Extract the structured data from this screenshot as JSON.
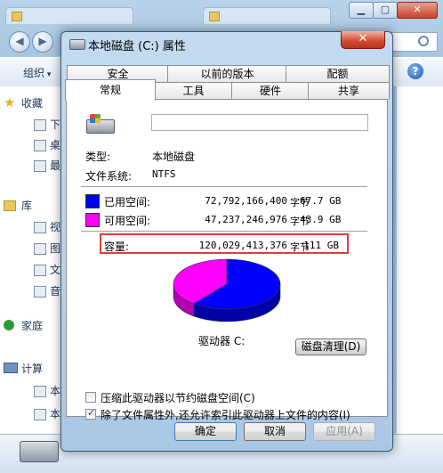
{
  "background": {
    "tabs": [
      "",
      ""
    ],
    "organize_label": "组织",
    "help_glyph": "?",
    "nav_items": [
      "收藏",
      "下",
      "桌",
      "最",
      "库",
      "视",
      "图",
      "文",
      "音",
      "家庭",
      "计算",
      "本",
      "本"
    ]
  },
  "dialog": {
    "title": "本地磁盘 (C:) 属性",
    "close_glyph": "✕",
    "tabs_back": [
      "安全",
      "以前的版本",
      "配额"
    ],
    "tabs_front": [
      "常规",
      "工具",
      "硬件",
      "共享"
    ],
    "name_value": "",
    "type_label": "类型:",
    "type_value": "本地磁盘",
    "fs_label": "文件系统:",
    "fs_value": "NTFS",
    "used": {
      "label": "已用空间:",
      "bytes": "72,792,166,400",
      "unit": "字节",
      "gb": "67.7 GB",
      "color": "#0000ff"
    },
    "free": {
      "label": "可用空间:",
      "bytes": "47,237,246,976",
      "unit": "字节",
      "gb": "43.9 GB",
      "color": "#ff00ff"
    },
    "capacity": {
      "label": "容量:",
      "bytes": "120,029,413,376",
      "unit": "字节",
      "gb": "111 GB"
    },
    "used_fraction": 0.606,
    "drive_label": "驱动器 C:",
    "cleanup_label": "磁盘清理(D)",
    "compress_label": "压缩此驱动器以节约磁盘空间(C)",
    "compress_checked": false,
    "index_label": "除了文件属性外,还允许索引此驱动器上文件的内容(I)",
    "index_checked": true,
    "ok_label": "确定",
    "cancel_label": "取消",
    "apply_label": "应用(A)",
    "highlight_color": "#e03c3c"
  }
}
